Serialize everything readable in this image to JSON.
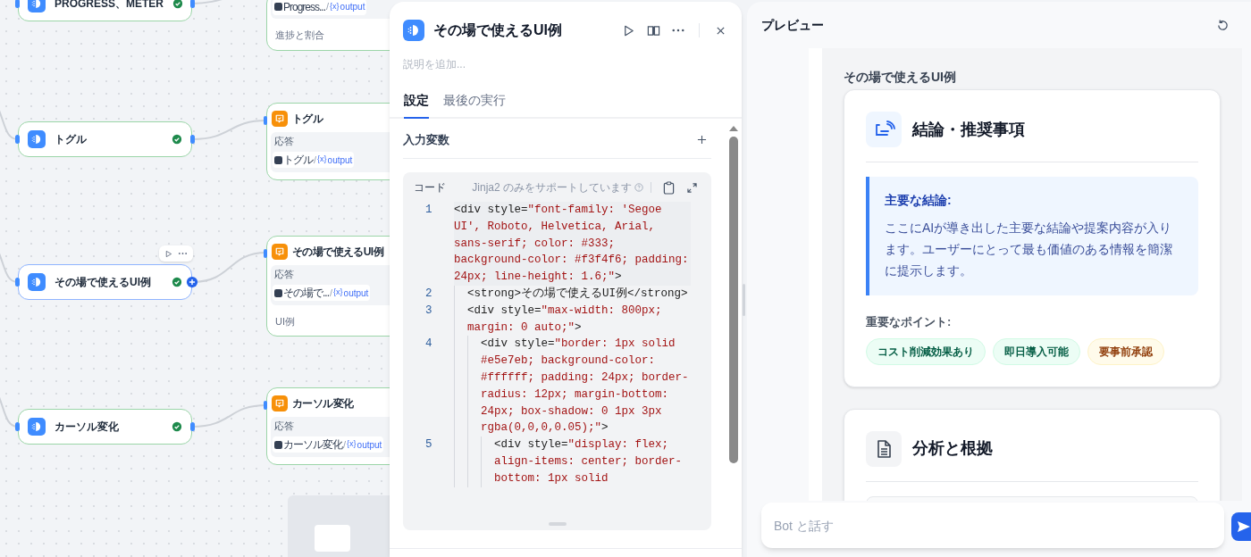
{
  "canvas": {
    "code_nodes": [
      {
        "title": "PROGRESS、METER",
        "succeeded": true,
        "selected": false
      },
      {
        "title": "トグル",
        "succeeded": true,
        "selected": false
      },
      {
        "title": "その場で使えるUI例",
        "succeeded": true,
        "selected": true
      },
      {
        "title": "カーソル変化",
        "succeeded": true,
        "selected": false
      }
    ],
    "answer_nodes": [
      {
        "chip": {
          "source": "Progress...",
          "separator": "/",
          "variable_icon": "{x}",
          "variable": "output"
        },
        "footnote": "進捗と割合"
      },
      {
        "title": "トグル",
        "label": "応答",
        "chip": {
          "source": "トグル",
          "separator": "/",
          "variable_icon": "{x}",
          "variable": "output"
        }
      },
      {
        "title": "その場で使えるUI例",
        "label": "応答",
        "chip": {
          "source": "その場で...",
          "separator": "/",
          "variable_icon": "{x}",
          "variable": "output"
        },
        "footnote": "UI例"
      },
      {
        "title": "カーソル変化",
        "label": "応答",
        "chip": {
          "source": "カーソル変化",
          "separator": "/",
          "variable_icon": "{x}",
          "variable": "output"
        }
      }
    ]
  },
  "editor": {
    "title": "その場で使えるUI例",
    "description_placeholder": "説明を追加...",
    "tabs": [
      {
        "label": "設定",
        "selected": true
      },
      {
        "label": "最後の実行",
        "selected": false
      }
    ],
    "input_section": "入力変数",
    "code": {
      "label": "コード",
      "hint": "Jinja2 のみをサポートしています",
      "lines": [
        {
          "number": "1",
          "parts": [
            {
              "kind": "tag",
              "text": "<div style="
            },
            {
              "kind": "string",
              "text": "\"font-family: 'Segoe UI', Roboto, Helvetica, Arial, sans-serif; color: #333; background-color: #f3f4f6; padding: 24px; line-height: 1.6;\""
            },
            {
              "kind": "tag",
              "text": ">"
            }
          ],
          "children": [
            {
              "number": "2",
              "parts": [
                {
                  "kind": "tag",
                  "text": "<strong>その場で使えるUI例</strong>"
                }
              ]
            },
            {
              "number": "3",
              "parts": [
                {
                  "kind": "tag",
                  "text": "<div style="
                },
                {
                  "kind": "string",
                  "text": "\"max-width: 800px; margin: 0 auto;\""
                },
                {
                  "kind": "tag",
                  "text": ">"
                }
              ],
              "children": [
                {
                  "number": "4",
                  "parts": [
                    {
                      "kind": "tag",
                      "text": "<div style="
                    },
                    {
                      "kind": "string",
                      "text": "\"border: 1px solid #e5e7eb; background-color: #ffffff; padding: 24px; border-radius: 12px; margin-bottom: 24px; box-shadow: 0 1px 3px rgba(0,0,0,0.05);\""
                    },
                    {
                      "kind": "tag",
                      "text": ">"
                    }
                  ],
                  "children": [
                    {
                      "number": "5",
                      "parts": [
                        {
                          "kind": "tag",
                          "text": "<div style="
                        },
                        {
                          "kind": "string",
                          "text": "\"display: flex; align-items: center; border-bottom: 1px solid"
                        }
                      ]
                    }
                  ]
                }
              ]
            }
          ]
        }
      ]
    }
  },
  "preview": {
    "title": "プレビュー",
    "page_title": "その場で使えるUI例",
    "cards": [
      {
        "kind": "conclusion",
        "heading": "結論・推奨事項",
        "callout": {
          "title": "主要な結論:",
          "text": "ここにAIが導き出した主要な結論や提案内容が入ります。ユーザーにとって最も価値のある情報を簡潔に提示します。"
        },
        "points_label": "重要なポイント:",
        "tags": [
          {
            "label": "コスト削減効果あり",
            "kind": "positive"
          },
          {
            "label": "即日導入可能",
            "kind": "positive"
          },
          {
            "label": "要事前承認",
            "kind": "caution"
          }
        ]
      },
      {
        "kind": "analysis",
        "heading": "分析と根拠"
      }
    ],
    "chat": {
      "placeholder": "Bot と話す"
    }
  }
}
